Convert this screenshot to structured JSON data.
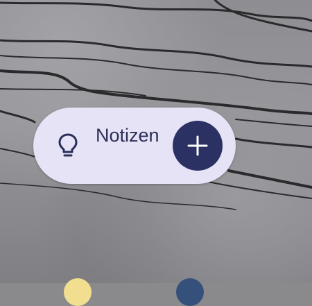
{
  "widget": {
    "label": "Notizen",
    "icon": "lightbulb-icon",
    "action_icon": "plus-icon"
  },
  "colors": {
    "widget_background": "#e6e3f6",
    "accent": "#2b3263",
    "text": "#2b2f58"
  }
}
